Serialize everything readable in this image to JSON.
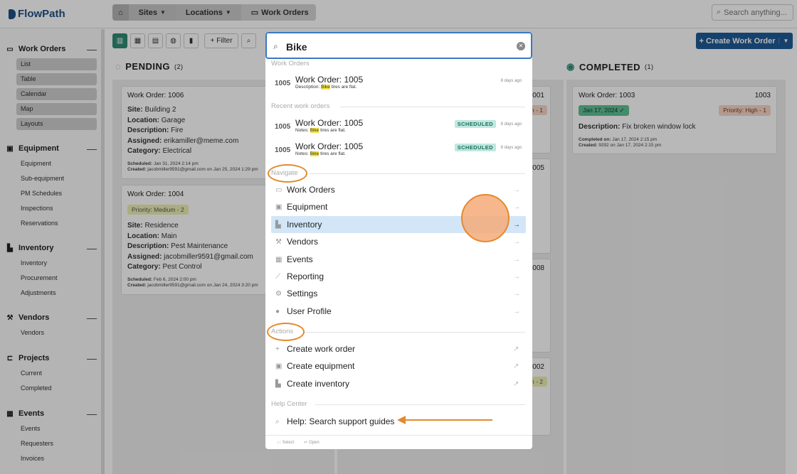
{
  "app": {
    "name": "FlowPath"
  },
  "breadcrumbs": {
    "home": "⌂",
    "sites": "Sites",
    "locations": "Locations",
    "current": "Work Orders"
  },
  "top_search": {
    "placeholder": "Search anything..."
  },
  "sidebar": {
    "sections": [
      {
        "title": "Work Orders",
        "items": [
          "List",
          "Table",
          "Calendar",
          "Map",
          "Layouts"
        ]
      },
      {
        "title": "Equipment",
        "items": [
          "Equipment",
          "Sub-equipment",
          "PM Schedules",
          "Inspections",
          "Reservations"
        ]
      },
      {
        "title": "Inventory",
        "items": [
          "Inventory",
          "Procurement",
          "Adjustments"
        ]
      },
      {
        "title": "Vendors",
        "items": [
          "Vendors"
        ]
      },
      {
        "title": "Projects",
        "items": [
          "Current",
          "Completed"
        ]
      },
      {
        "title": "Events",
        "items": [
          "Events",
          "Requesters",
          "Invoices"
        ]
      }
    ]
  },
  "toolbar": {
    "filter_label": "Filter",
    "create_label": "Create Work Order"
  },
  "board": {
    "pending": {
      "title": "PENDING",
      "count": "(2)"
    },
    "completed": {
      "title": "COMPLETED",
      "count": "(1)"
    },
    "cards": {
      "c1006": {
        "title": "Work Order: 1006",
        "site": "Building 2",
        "location": "Garage",
        "description": "Fire",
        "assigned": "erikamiller@meme.com",
        "category": "Electrical",
        "scheduled": "Jan 31, 2024 2:14 pm",
        "created": "jacobmiller9591@gmail.com on Jan 25, 2024 1:29 pm"
      },
      "c1004": {
        "title": "Work Order: 1004",
        "priority": "Priority: Medium - 2",
        "site": "Residence",
        "location": "Main",
        "description": "Pest Maintenance",
        "assigned": "jacobmiller9591@gmail.com",
        "category": "Pest Control",
        "scheduled": "Feb 6, 2024 2:00 pm",
        "created": "jacobmiller9591@gmail.com on Jan 24, 2024 3:20 pm"
      },
      "c1003": {
        "title": "Work Order: 1003",
        "num": "1003",
        "date": "Jan 17, 2024 ✓",
        "priority": "Priority: High - 1",
        "description": "Fix broken window lock",
        "completed": "Jan 17, 2024 2:15 pm",
        "created": "9292 on Jan 17, 2024 2:15 pm"
      },
      "mid": {
        "n1": "1001",
        "n2": "1005",
        "n3": "1008",
        "n4": "1002",
        "p1": "h - 1",
        "p2": "m - 2"
      }
    },
    "labels": {
      "site": "Site:",
      "location": "Location:",
      "description": "Description:",
      "assigned": "Assigned:",
      "category": "Category:",
      "scheduled": "Scheduled:",
      "created": "Created:",
      "completed_on": "Completed on:"
    }
  },
  "palette": {
    "query": "Bike",
    "groups": {
      "work_orders": "Work Orders",
      "recent": "Recent work orders",
      "navigate": "Navigate",
      "actions": "Actions",
      "help": "Help Center"
    },
    "results": [
      {
        "num": "1005",
        "title": "Work Order: 1005",
        "prefix": "Description:",
        "match": "Bike",
        "rest": "tires are flat.",
        "ago": "8 days ago"
      }
    ],
    "recent": [
      {
        "num": "1005",
        "title": "Work Order: 1005",
        "prefix": "Notes:",
        "match": "Bike",
        "rest": "tires are flat.",
        "badge": "SCHEDULED",
        "ago": "8 days ago"
      },
      {
        "num": "1005",
        "title": "Work Order: 1005",
        "prefix": "Notes:",
        "match": "Bike",
        "rest": "tires are flat.",
        "badge": "SCHEDULED",
        "ago": "8 days ago"
      }
    ],
    "navigate": [
      "Work Orders",
      "Equipment",
      "Inventory",
      "Vendors",
      "Events",
      "Reporting",
      "Settings",
      "User Profile"
    ],
    "actions": [
      "Create work order",
      "Create equipment",
      "Create inventory"
    ],
    "help": [
      "Help: Search support guides"
    ],
    "footer": {
      "select": "↓↑ Select",
      "open": "↵ Open"
    }
  }
}
